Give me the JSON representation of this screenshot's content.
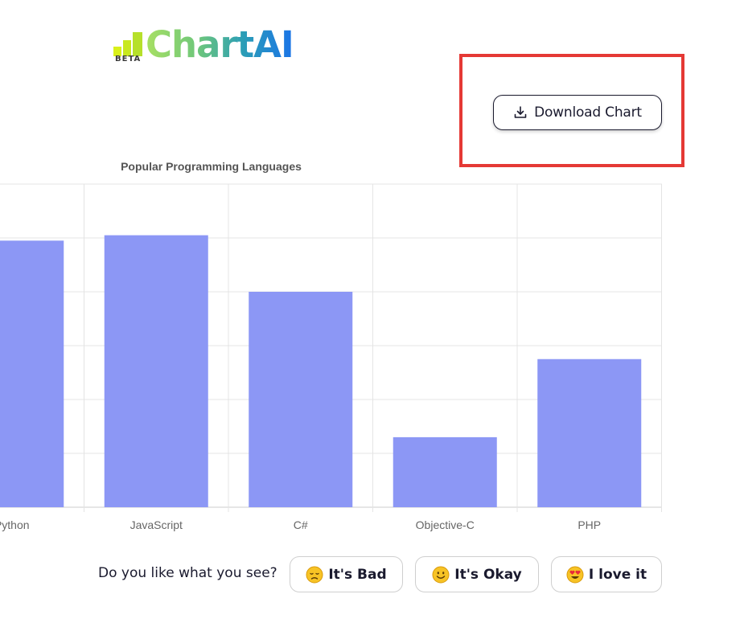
{
  "logo": {
    "badge": "BETA",
    "name": "ChartAI"
  },
  "toolbar": {
    "download_label": "Download Chart",
    "download_icon": "download-icon"
  },
  "highlight": {
    "color": "#e53935"
  },
  "chart_data": {
    "type": "bar",
    "title": "Popular Programming Languages",
    "categories": [
      "Python",
      "JavaScript",
      "C#",
      "Objective-C",
      "PHP"
    ],
    "values": [
      99,
      101,
      80,
      26,
      55
    ],
    "ylim": [
      0,
      120
    ],
    "grid": true,
    "bar_color": "#8c97f5",
    "xlabel": "",
    "ylabel": ""
  },
  "feedback": {
    "prompt": "Do you like what you see?",
    "options": [
      {
        "label": "It's Bad",
        "icon": "sad-face-icon"
      },
      {
        "label": "It's Okay",
        "icon": "smile-face-icon"
      },
      {
        "label": "I love it",
        "icon": "heart-eyes-icon"
      }
    ]
  }
}
